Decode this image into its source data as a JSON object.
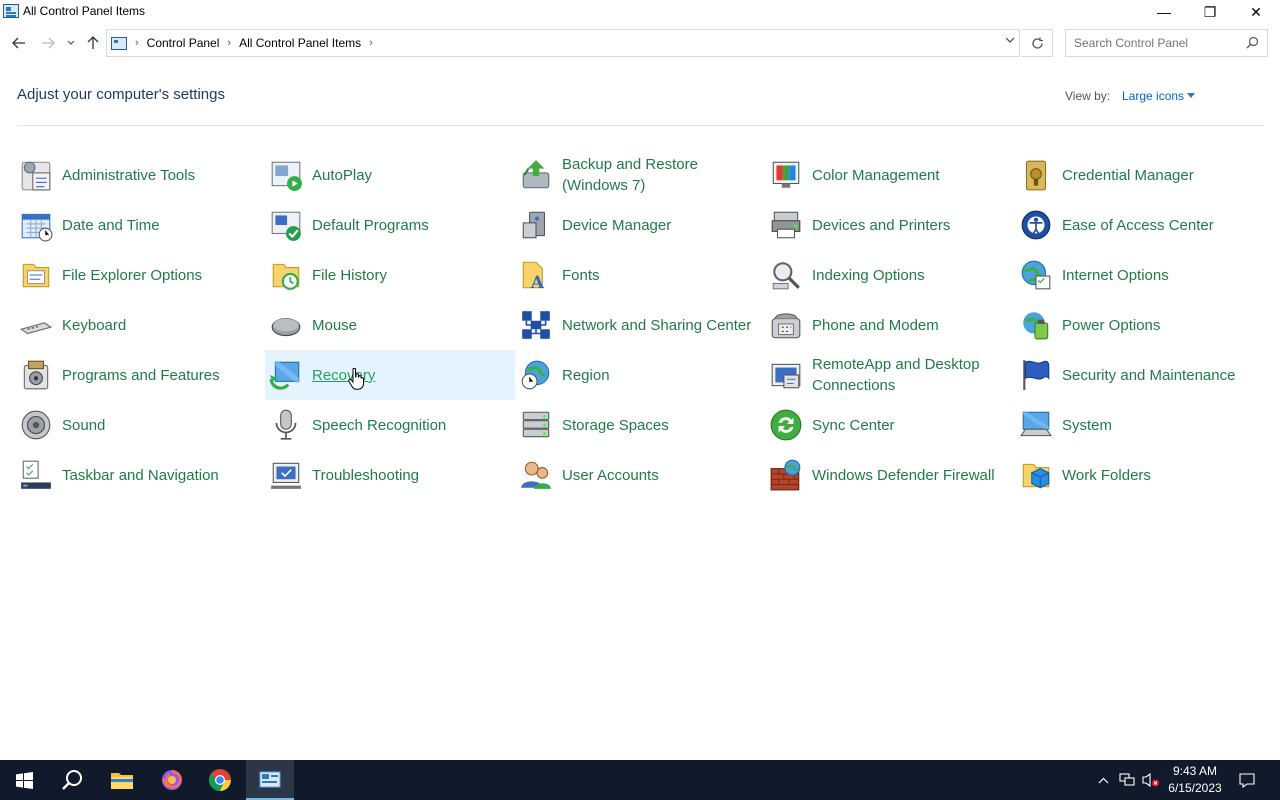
{
  "window": {
    "title": "All Control Panel Items",
    "minimize_glyph": "—",
    "restore_glyph": "❐",
    "close_glyph": "✕"
  },
  "nav": {
    "breadcrumbs": [
      "Control Panel",
      "All Control Panel Items"
    ],
    "breadcrumb_separator": "›",
    "search_placeholder": "Search Control Panel"
  },
  "header": {
    "title": "Adjust your computer's settings",
    "view_by_label": "View by:",
    "view_by_value": "Large icons"
  },
  "items": [
    [
      "Administrative Tools",
      "AutoPlay",
      "Backup and Restore (Windows 7)",
      "Color Management",
      "Credential Manager"
    ],
    [
      "Date and Time",
      "Default Programs",
      "Device Manager",
      "Devices and Printers",
      "Ease of Access Center"
    ],
    [
      "File Explorer Options",
      "File History",
      "Fonts",
      "Indexing Options",
      "Internet Options"
    ],
    [
      "Keyboard",
      "Mouse",
      "Network and Sharing Center",
      "Phone and Modem",
      "Power Options"
    ],
    [
      "Programs and Features",
      "Recovery",
      "Region",
      "RemoteApp and Desktop Connections",
      "Security and Maintenance"
    ],
    [
      "Sound",
      "Speech Recognition",
      "Storage Spaces",
      "Sync Center",
      "System"
    ],
    [
      "Taskbar and Navigation",
      "Troubleshooting",
      "User Accounts",
      "Windows Defender Firewall",
      "Work Folders"
    ]
  ],
  "hovered_item": "Recovery",
  "taskbar": {
    "time": "9:43 AM",
    "date": "6/15/2023",
    "apps": [
      "start-icon",
      "search-icon",
      "file-explorer-icon",
      "firefox-icon",
      "chrome-icon",
      "control-panel-icon"
    ]
  },
  "colors": {
    "link_green": "#217a4a",
    "hover_bg": "#e5f3ff",
    "taskbar_bg": "#101a2b"
  }
}
